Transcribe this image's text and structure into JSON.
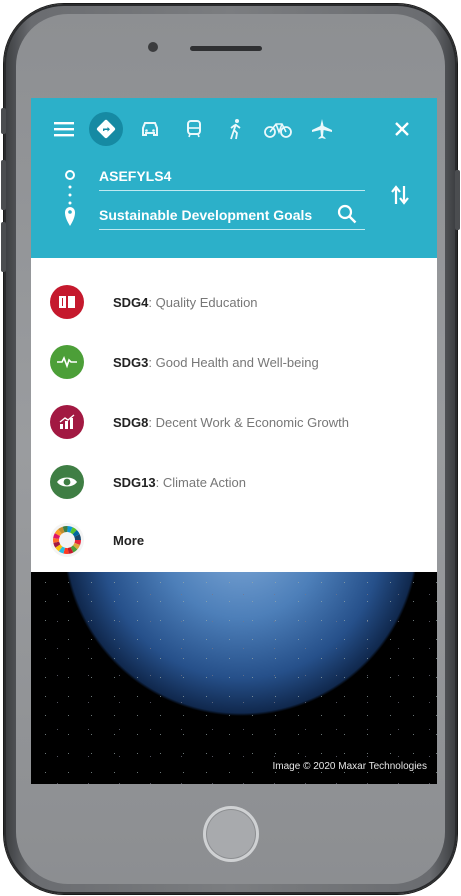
{
  "toolbar": {
    "menu_icon": "menu-icon",
    "modes": [
      "directions-icon",
      "car-icon",
      "transit-icon",
      "walk-icon",
      "bike-icon",
      "flight-icon"
    ],
    "close_icon": "close-icon",
    "accent": "#2cb0c9",
    "active_bg": "#168aa3"
  },
  "route": {
    "origin": "ASEFYLS4",
    "destination": "Sustainable Development Goals"
  },
  "results": [
    {
      "code": "SDG4",
      "title": ": Quality Education",
      "color": "#c5192d"
    },
    {
      "code": "SDG3",
      "title": ": Good Health and Well-being",
      "color": "#4c9f38"
    },
    {
      "code": "SDG8",
      "title": ": Decent Work & Economic Growth",
      "color": "#a21942"
    },
    {
      "code": "SDG13",
      "title": ": Climate Action",
      "color": "#3f7e44"
    }
  ],
  "more_label": "More",
  "credit": "Image © 2020 Maxar Technologies"
}
